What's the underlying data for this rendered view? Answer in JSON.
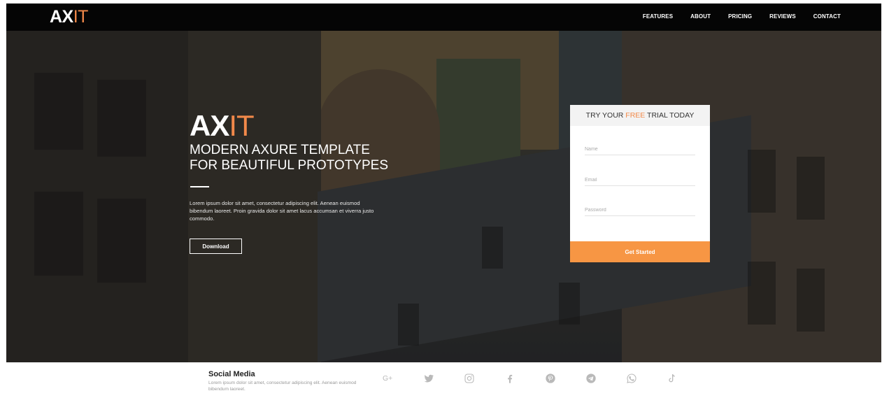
{
  "header": {
    "logo_a": "AX",
    "logo_b": "IT",
    "nav": [
      "FEATURES",
      "ABOUT",
      "PRICING",
      "REVIEWS",
      "CONTACT"
    ]
  },
  "hero": {
    "logo_a": "AX",
    "logo_b": "IT",
    "title_line1": "MODERN AXURE TEMPLATE",
    "title_line2": "FOR BEAUTIFUL PROTOTYPES",
    "text": "Lorem ipsum dolor sit amet, consectetur adipiscing elit. Aenean euismod bibendum laoreet. Proin gravida dolor sit amet lacus accumsan et viverra justo commodo.",
    "button": "Download"
  },
  "trial_form": {
    "heading_pre": "TRY YOUR ",
    "heading_hl": "FREE",
    "heading_post": " TRIAL TODAY",
    "name_placeholder": "Name",
    "email_placeholder": "Email",
    "password_placeholder": "Password",
    "submit": "Get Started"
  },
  "social": {
    "title": "Social Media",
    "text": "Lorem ipsum dolor sit amet, consectetur adipiscing elit. Aenean euismod bibendum laoreet.",
    "icons": [
      "google-plus-icon",
      "twitter-icon",
      "instagram-icon",
      "facebook-icon",
      "pinterest-icon",
      "telegram-icon",
      "whatsapp-icon",
      "tiktok-icon"
    ]
  },
  "colors": {
    "accent": "#f2894a",
    "button": "#f79644",
    "topbar": "#050505"
  }
}
